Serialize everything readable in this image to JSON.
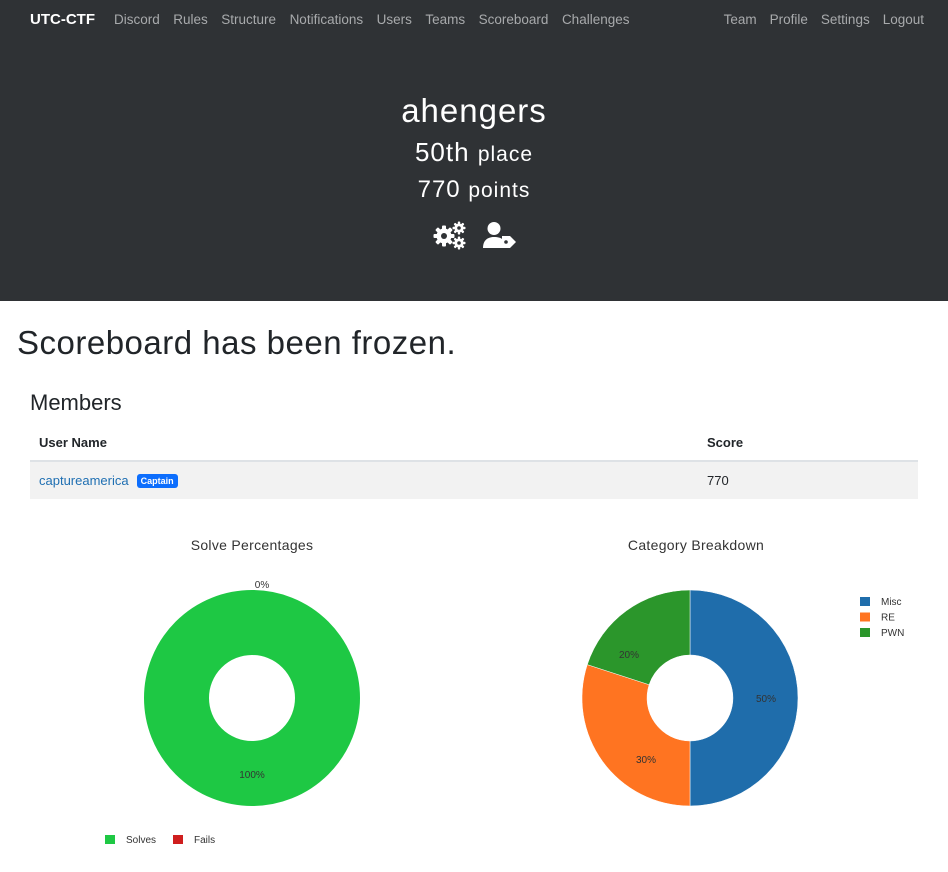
{
  "navbar": {
    "brand": "UTC-CTF",
    "left_items": [
      "Discord",
      "Rules",
      "Structure",
      "Notifications",
      "Users",
      "Teams",
      "Scoreboard",
      "Challenges"
    ],
    "right_items": [
      "Team",
      "Profile",
      "Settings",
      "Logout"
    ]
  },
  "team": {
    "name": "ahengers",
    "place_number": "50th",
    "place_label": "place",
    "points_number": "770",
    "points_label": "points",
    "icons": [
      "settings-gears-icon",
      "user-tag-icon"
    ]
  },
  "notice": "Scoreboard has been frozen.",
  "members": {
    "title": "Members",
    "columns": [
      "User Name",
      "Score"
    ],
    "rows": [
      {
        "user": "captureamerica",
        "badge": "Captain",
        "score": "770"
      }
    ]
  },
  "chart_data": [
    {
      "type": "pie",
      "title": "Solve Percentages",
      "labels": [
        "Solves",
        "Fails"
      ],
      "values": [
        100,
        0
      ],
      "colors": [
        "#1ec844",
        "#cf1e1e"
      ],
      "data_labels": [
        "100%",
        "0%"
      ],
      "legend": "bottom"
    },
    {
      "type": "pie",
      "title": "Category Breakdown",
      "labels": [
        "Misc",
        "RE",
        "PWN"
      ],
      "values": [
        50,
        30,
        20
      ],
      "colors": [
        "#1f6dab",
        "#ff7421",
        "#2b962b"
      ],
      "data_labels": [
        "50%",
        "30%",
        "20%"
      ],
      "legend": "right"
    }
  ]
}
